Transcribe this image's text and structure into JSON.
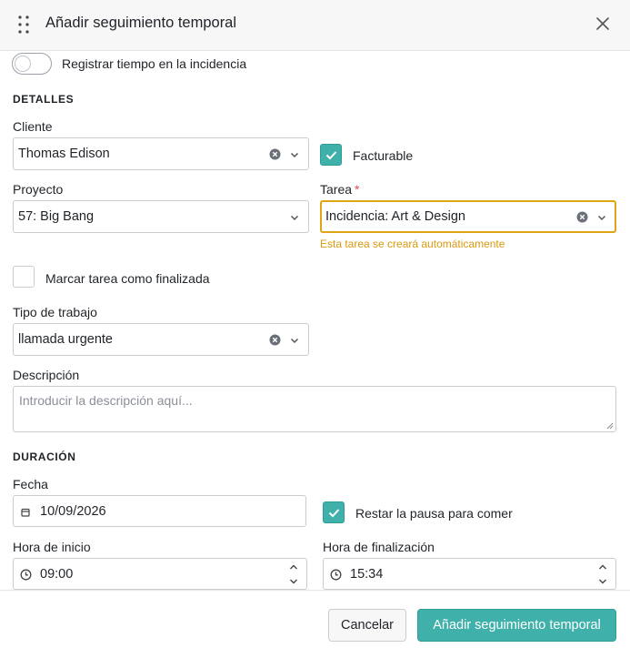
{
  "dialog": {
    "title": "Añadir seguimiento temporal"
  },
  "toggle": {
    "label": "Registrar tiempo en la incidencia",
    "on": false
  },
  "details": {
    "section_title": "DETALLES",
    "client": {
      "label": "Cliente",
      "value": "Thomas Edison"
    },
    "billable": {
      "label": "Facturable",
      "checked": true
    },
    "project": {
      "label": "Proyecto",
      "value": "57: Big Bang"
    },
    "task": {
      "label": "Tarea",
      "required_mark": "*",
      "value": "Incidencia: Art & Design",
      "hint": "Esta tarea se creará automáticamente"
    },
    "mark_done": {
      "label": "Marcar tarea como finalizada",
      "checked": false
    },
    "work_type": {
      "label": "Tipo de trabajo",
      "value": "llamada urgente"
    },
    "description": {
      "label": "Descripción",
      "placeholder": "Introducir la descripción aquí..."
    }
  },
  "duration": {
    "section_title": "DURACIÓN",
    "date": {
      "label": "Fecha",
      "value": "10/09/2026"
    },
    "lunch_break": {
      "label": "Restar la pausa para comer",
      "checked": true
    },
    "start": {
      "label": "Hora de inicio",
      "value": "09:00"
    },
    "end": {
      "label": "Hora de finalización",
      "value": "15:34"
    }
  },
  "footer": {
    "cancel_label": "Cancelar",
    "add_label": "Añadir seguimiento temporal"
  },
  "colors": {
    "accent": "#3fb1aa",
    "warning": "#e0a516",
    "required": "#e24b4b"
  }
}
